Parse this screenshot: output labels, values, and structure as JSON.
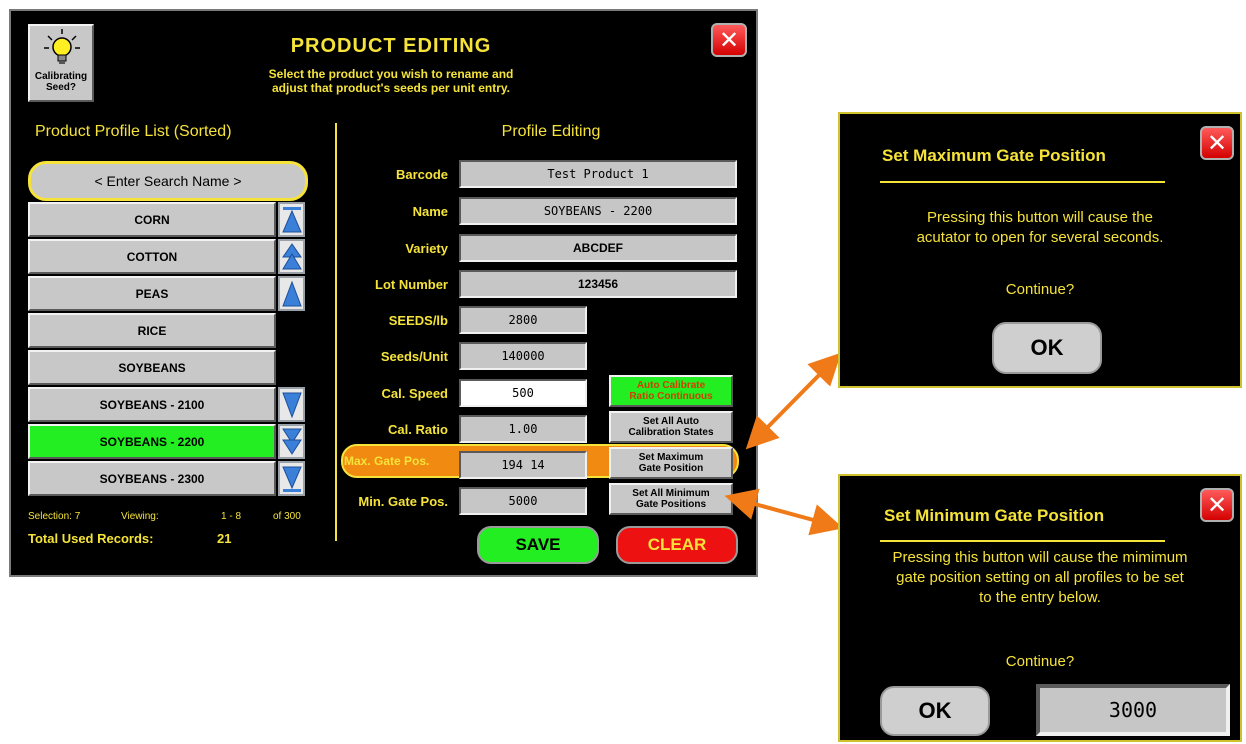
{
  "header": {
    "title": "PRODUCT EDITING",
    "subtitle_line1": "Select the product you wish to rename and",
    "subtitle_line2": "adjust that product's seeds per unit entry.",
    "calibrating_line1": "Calibrating",
    "calibrating_line2": "Seed?",
    "close_symbol": "✕"
  },
  "left": {
    "heading": "Product Profile List (Sorted)",
    "search_placeholder": "< Enter Search Name >",
    "items": [
      {
        "label": "CORN"
      },
      {
        "label": "COTTON"
      },
      {
        "label": "PEAS"
      },
      {
        "label": "RICE"
      },
      {
        "label": "SOYBEANS"
      },
      {
        "label": "SOYBEANS  -  2100"
      },
      {
        "label": "SOYBEANS  -  2200",
        "selected": true
      },
      {
        "label": "SOYBEANS  -  2300"
      }
    ],
    "footer": {
      "selection": "Selection: 7",
      "viewing": "Viewing:",
      "range": "1 - 8",
      "of": "of 300",
      "total_label": "Total Used Records:",
      "total_value": "21"
    }
  },
  "right": {
    "heading": "Profile Editing",
    "barcode_label": "Barcode",
    "barcode_value": "Test  Product  1",
    "name_label": "Name",
    "name_value": "SOYBEANS  -  2200",
    "variety_label": "Variety",
    "variety_value": "ABCDEF",
    "lot_label": "Lot Number",
    "lot_value": "123456",
    "seedslb_label": "SEEDS/lb",
    "seedslb_value": "2800",
    "seedsunit_label": "Seeds/Unit",
    "seedsunit_value": "140000",
    "calspeed_label": "Cal. Speed",
    "calspeed_value": "500",
    "calratio_label": "Cal. Ratio",
    "calratio_value": "1.00",
    "maxgate_label": "Max. Gate Pos.",
    "maxgate_value": "194 14",
    "mingate_label": "Min. Gate Pos.",
    "mingate_value": "5000",
    "auto_cal_line1": "Auto Calibrate",
    "auto_cal_line2": "Ratio Continuous",
    "set_all_auto_line1": "Set All Auto",
    "set_all_auto_line2": "Calibration States",
    "set_max_line1": "Set Maximum",
    "set_max_line2": "Gate Position",
    "set_all_min_line1": "Set All Minimum",
    "set_all_min_line2": "Gate Positions",
    "save_label": "SAVE",
    "clear_label": "CLEAR"
  },
  "dialog_max": {
    "title": "Set Maximum Gate Position",
    "line1": "Pressing this button will cause the",
    "line2": "acutator to open for several seconds.",
    "continue": "Continue?",
    "ok": "OK"
  },
  "dialog_min": {
    "title": "Set Minimum Gate Position",
    "line1": "Pressing this button will cause the mimimum",
    "line2": "gate position setting on all profiles to be set",
    "line3": "to the entry below.",
    "continue": "Continue?",
    "ok": "OK",
    "value": "3000"
  },
  "colors": {
    "yellow": "#f5e33a",
    "selected_green": "#22ee22",
    "save_green": "#22ee22",
    "clear_red": "#ee1111",
    "highlight_orange": "#f08a10",
    "dialog_border": "#cfc22c"
  }
}
